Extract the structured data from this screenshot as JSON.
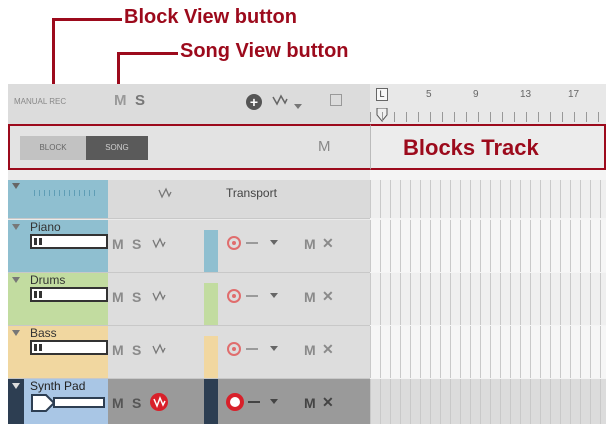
{
  "callouts": {
    "block_view": "Block View button",
    "song_view": "Song View button",
    "blocks_track": "Blocks Track"
  },
  "toolbar": {
    "manual_rec": "MANUAL REC",
    "m": "M",
    "s": "S",
    "ruler_marks": [
      "5",
      "9",
      "13",
      "17"
    ],
    "loop_start_label": "L"
  },
  "view_buttons": {
    "block": "BLOCK",
    "song": "SONG",
    "m": "M"
  },
  "transport": {
    "label": "Transport"
  },
  "tracks": [
    {
      "name": "Piano",
      "color": "#8fbfd0",
      "m": "M",
      "s": "S",
      "mute": "M",
      "remove": "✕"
    },
    {
      "name": "Drums",
      "color": "#c2dca0",
      "m": "M",
      "s": "S",
      "mute": "M",
      "remove": "✕"
    },
    {
      "name": "Bass",
      "color": "#f1d7a0",
      "m": "M",
      "s": "S",
      "mute": "M",
      "remove": "✕"
    },
    {
      "name": "Synth Pad",
      "color": "#a9c6e5",
      "m": "M",
      "s": "S",
      "mute": "M",
      "remove": "✕"
    }
  ],
  "colors": {
    "accent": "#9c0a1c",
    "record_red": "#e06d6d",
    "selected_red": "#d8202a"
  }
}
